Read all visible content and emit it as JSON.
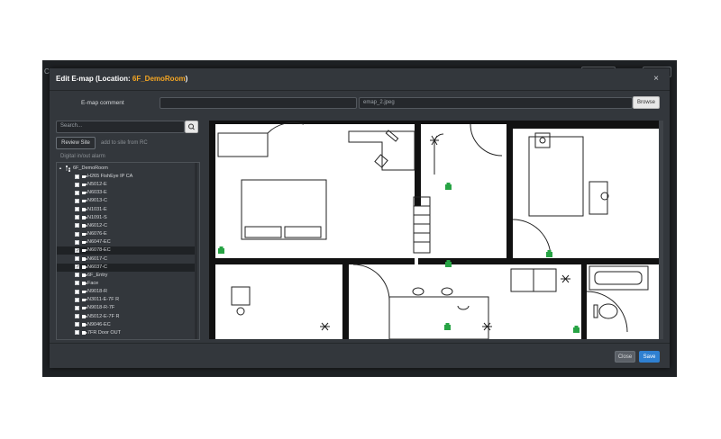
{
  "modal": {
    "title_prefix": "Edit E-map (Location: ",
    "location": "6F_DemoRoom",
    "title_suffix": ")",
    "close_glyph": "×"
  },
  "form": {
    "emap_comment_label": "E-map comment",
    "emap_comment_value": "",
    "image_file_value": "emap_2.jpeg",
    "browse_label": "Browse"
  },
  "search": {
    "placeholder": "Search..."
  },
  "review_site_label": "Review Site",
  "add_to_site_hint": "add to site from RC",
  "digital_alarm_label": "Digital in/out alarm",
  "tree": {
    "root": "6F_DemoRoom",
    "items": [
      {
        "label": "H265 FishEye IP CA",
        "checked": false,
        "type": "camera"
      },
      {
        "label": "N5012-E",
        "checked": false,
        "type": "camera"
      },
      {
        "label": "N6033-E",
        "checked": false,
        "type": "camera"
      },
      {
        "label": "N9013-C",
        "checked": false,
        "type": "camera"
      },
      {
        "label": "N1031-E",
        "checked": false,
        "type": "camera"
      },
      {
        "label": "N1091-S",
        "checked": false,
        "type": "camera"
      },
      {
        "label": "N6012-C",
        "checked": false,
        "type": "camera"
      },
      {
        "label": "N6076-E",
        "checked": false,
        "type": "camera"
      },
      {
        "label": "N6047-EC",
        "checked": false,
        "type": "camera"
      },
      {
        "label": "N6078-EC",
        "checked": true,
        "type": "camera"
      },
      {
        "label": "N6017-C",
        "checked": false,
        "type": "camera"
      },
      {
        "label": "N6037-C",
        "checked": true,
        "type": "camera"
      },
      {
        "label": "6F_Entry",
        "checked": false,
        "type": "door"
      },
      {
        "label": "Face",
        "checked": false,
        "type": "camera"
      },
      {
        "label": "N9018-R",
        "checked": false,
        "type": "camera"
      },
      {
        "label": "N3011-E-7F R",
        "checked": false,
        "type": "camera"
      },
      {
        "label": "N9018-R-7F",
        "checked": false,
        "type": "camera"
      },
      {
        "label": "N5012-E-7F R",
        "checked": false,
        "type": "camera"
      },
      {
        "label": "N9046-EC",
        "checked": false,
        "type": "camera"
      },
      {
        "label": "7FR Door OUT",
        "checked": false,
        "type": "door"
      }
    ]
  },
  "footer": {
    "close_label": "Close",
    "save_label": "Save"
  },
  "icons": {
    "search": "search-icon",
    "camera": "camera-icon",
    "door": "door-icon",
    "device_marker": "green-device-marker-icon"
  },
  "colors": {
    "accent_orange": "#f5a623",
    "primary_blue": "#2f80d1",
    "marker_green": "#27a344",
    "modal_bg": "#33373c"
  }
}
